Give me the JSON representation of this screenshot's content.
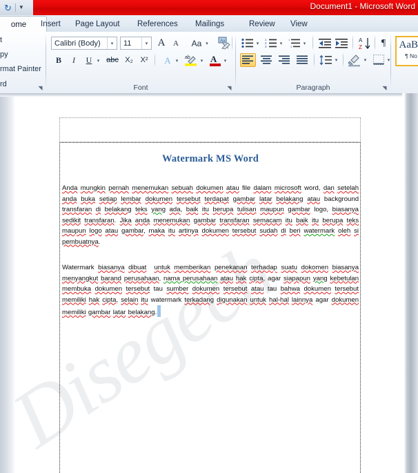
{
  "window": {
    "title": "Document1  -  Microsoft Word",
    "quick_access": {
      "undo_icon": "undo-icon",
      "more_icon": "chevron-down-icon"
    }
  },
  "tabs": [
    {
      "label": "ome",
      "active": true
    },
    {
      "label": "Insert",
      "active": false
    },
    {
      "label": "Page Layout",
      "active": false
    },
    {
      "label": "References",
      "active": false
    },
    {
      "label": "Mailings",
      "active": false
    },
    {
      "label": "Review",
      "active": false
    },
    {
      "label": "View",
      "active": false
    }
  ],
  "ribbon": {
    "clipboard": {
      "label": "rd",
      "items": [
        {
          "label": "t"
        },
        {
          "label": "py"
        },
        {
          "label": "rmat Painter"
        }
      ],
      "dialog_launcher": "◥"
    },
    "font": {
      "label": "Font",
      "dialog_launcher": "◥",
      "font_name": "Calibri (Body)",
      "font_size": "11",
      "grow_font": "A",
      "shrink_font": "A",
      "change_case": "Aa",
      "clear_formatting": "Aa",
      "bold": "B",
      "italic": "I",
      "underline": "U",
      "strikethrough": "abc",
      "subscript": "X₂",
      "superscript": "X²",
      "text_effects": "A",
      "highlight": "ab",
      "font_color": "A",
      "dropdown": "▾"
    },
    "paragraph": {
      "label": "Paragraph",
      "dialog_launcher": "◥",
      "bullets": "≔",
      "numbering": "≔",
      "multilevel": "≔",
      "decrease_indent": "⇤",
      "increase_indent": "⇥",
      "sort": "A\\nZ",
      "show_marks": "¶",
      "align_left": "≡",
      "align_center": "≡",
      "align_right": "≡",
      "justify": "≡",
      "line_spacing": "↕",
      "shading": "▨",
      "borders": "▤",
      "dropdown": "▾"
    },
    "styles": {
      "normal_preview": "AaBb",
      "normal_name": "¶ No"
    }
  },
  "document": {
    "watermark_text": "Disegech",
    "heading": "Watermark MS Word",
    "paragraph_1": "Anda mungkin pernah menemukan sebuah dokumen atau file dalam microsoft word, dan setelah anda buka setiap lembar dokumen tersebut terdapat gambar latar belakang atau background transfaran di belakang teks yang ada, baik itu berupa tulisan maupun gambar logo, biasanya sedikit transfaran. Jika anda menemukan gambar transfaran semacam itu baik itu berupa teks maupun logo atau gambar, maka itu artinya dokumen tersebut sudah di beri watermark oleh si pembuatnya.",
    "paragraph_2": "Watermark biasanya dibuat  untuk memberikan penekanan terhadap suatu dokomen biasanya menyangkut barand perusahaan, nama perusahaan atau hak cipta, agar siapapun yang kebetulan membuka dokumen tersebut tau sumber dokumen tersebut atau tau bahwa dokumen tersebut memiliki hak cipta, selain itu watermark terkadang digunakan untuk hal-hal lainnya agar dokumen memiliki gambar latar belakang."
  },
  "colors": {
    "titlebar_red": "#e00606",
    "heading_blue": "#2b5c95",
    "watermark_gray": "#eceef0",
    "spell_error": "#e02020",
    "grammar_error": "#17a017",
    "selection_blue": "#9dc6ea",
    "accent_gold": "#f0b429"
  }
}
